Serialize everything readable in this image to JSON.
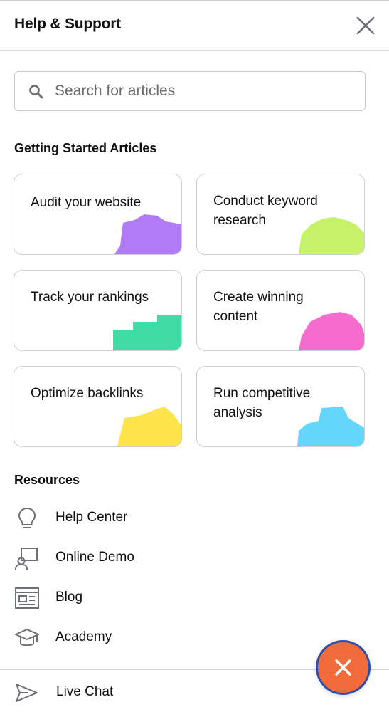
{
  "header": {
    "title": "Help & Support"
  },
  "search": {
    "placeholder": "Search for articles",
    "value": ""
  },
  "getting_started": {
    "title": "Getting Started Articles",
    "cards": [
      {
        "label": "Audit your website",
        "accent": "#b07cf6"
      },
      {
        "label": "Conduct keyword research",
        "accent": "#c6f26a"
      },
      {
        "label": "Track your rankings",
        "accent": "#3fdca5"
      },
      {
        "label": "Create winning content",
        "accent": "#f56cce"
      },
      {
        "label": "Optimize backlinks",
        "accent": "#fde44b"
      },
      {
        "label": "Run competitive analysis",
        "accent": "#64d6fb"
      }
    ]
  },
  "resources": {
    "title": "Resources",
    "items": [
      {
        "label": "Help Center",
        "icon": "lightbulb-icon"
      },
      {
        "label": "Online Demo",
        "icon": "presentation-icon"
      },
      {
        "label": "Blog",
        "icon": "newspaper-icon"
      },
      {
        "label": "Academy",
        "icon": "graduation-cap-icon"
      }
    ]
  },
  "bottom": {
    "live_chat_label": "Live Chat",
    "live_chat_icon": "send-icon"
  },
  "colors": {
    "fab": "#f26b3a",
    "fab_border": "#2b4fa8",
    "icon_gray": "#6b6f76"
  }
}
